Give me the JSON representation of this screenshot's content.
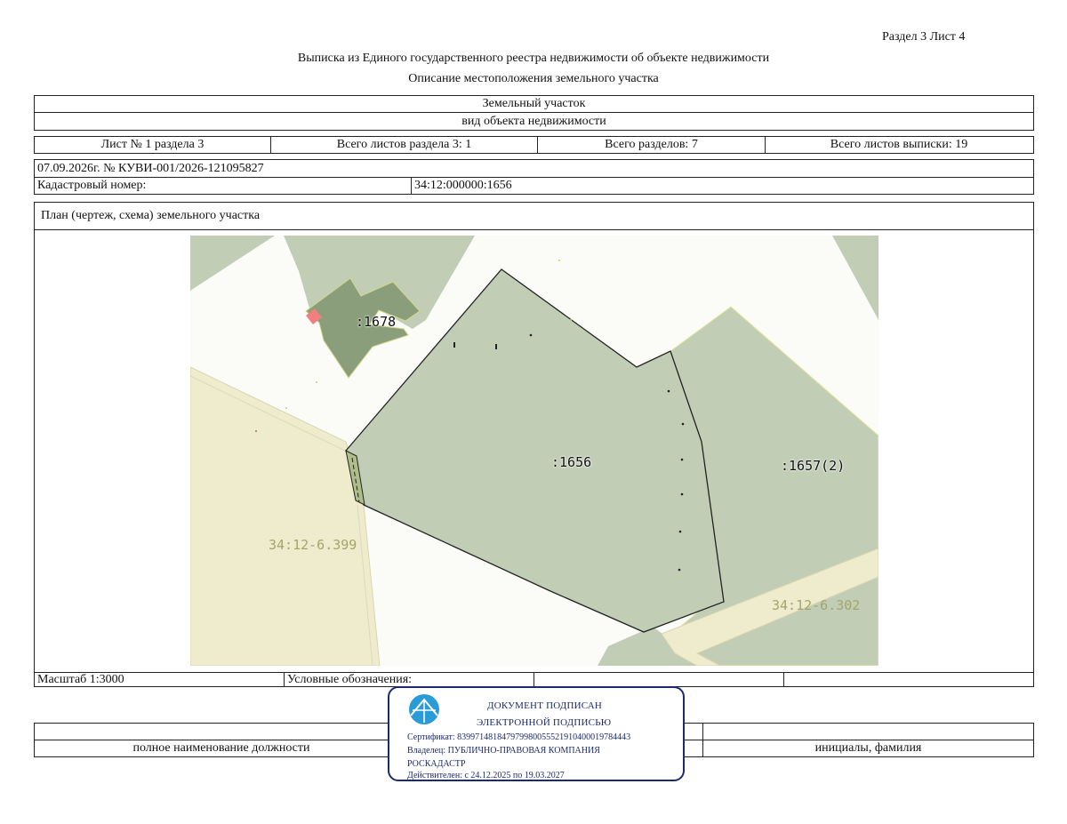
{
  "header": {
    "section_sheet": "Раздел 3    Лист 4",
    "title": "Выписка из Единого государственного реестра недвижимости об объекте недвижимости",
    "subtitle": "Описание местоположения земельного участка"
  },
  "object": {
    "type": "Земельный участок",
    "kind_label": "вид объекта недвижимости"
  },
  "sheets": {
    "sheet_no": "Лист № 1 раздела 3",
    "total_sheets_section": "Всего листов раздела 3: 1",
    "total_sections": "Всего разделов: 7",
    "total_sheets_extract": "Всего листов выписки: 19"
  },
  "record": {
    "date_number": "07.09.2026г. № КУВИ-001/2026-121095827",
    "cadastral_label": "Кадастровый номер:",
    "cadastral_value": "34:12:000000:1656"
  },
  "plan": {
    "title": "План (чертеж, схема) земельного участка",
    "labels": {
      "parcel_1678": ":1678",
      "parcel_1656": ":1656",
      "parcel_1657": ":1657(2)",
      "zone_399": "34:12-6.399",
      "zone_302": "34:12-6.302"
    },
    "colors": {
      "parcel_fill": "#c2cdb6",
      "building_fill": "#8a9e7c",
      "zone_fill": "#eeeccd",
      "background": "#fbfcf8",
      "boundary": "#222222",
      "zone_label": "#a6a46a",
      "marker": "#f08080"
    }
  },
  "footer": {
    "scale": "Масштаб 1:3000",
    "legend": "Условные обозначения:",
    "position_label": "полное наименование должности",
    "name_label": "инициалы, фамилия"
  },
  "stamp": {
    "line1": "ДОКУМЕНТ ПОДПИСАН",
    "line2": "ЭЛЕКТРОННОЙ ПОДПИСЬЮ",
    "certificate": "Сертификат: 839971481847979980055521910400019784443",
    "owner": "Владелец: ПУБЛИЧНО-ПРАВОВАЯ КОМПАНИЯ",
    "owner2": "РОСКАДАСТР",
    "valid": "Действителен: с 24.12.2025 по 19.03.2027",
    "color": "#1c2a6e",
    "icon": "roskadastr-logo-icon"
  }
}
